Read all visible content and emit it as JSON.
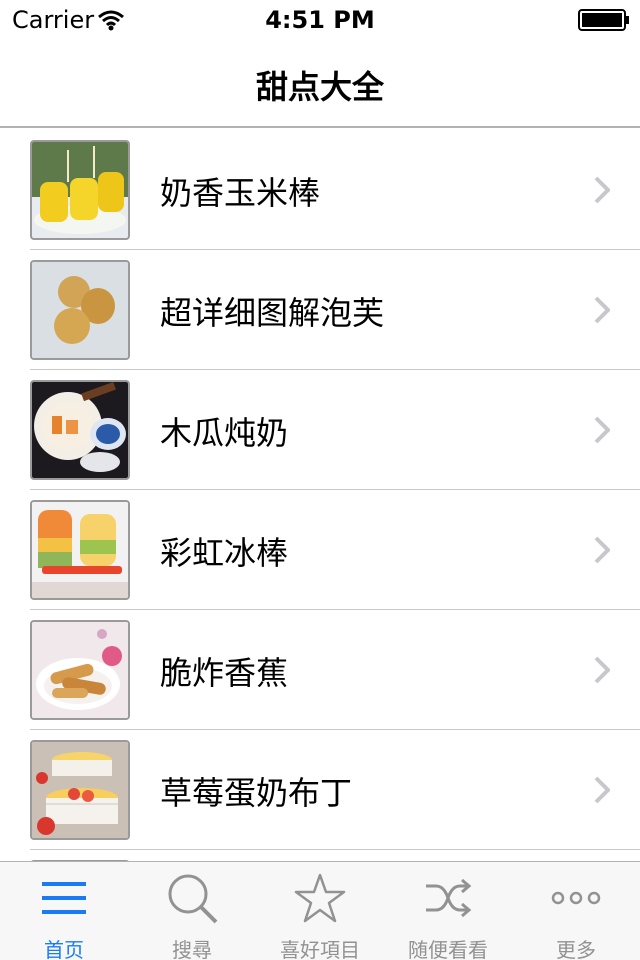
{
  "status_bar": {
    "carrier": "Carrier",
    "time": "4:51 PM"
  },
  "nav": {
    "title": "甜点大全"
  },
  "list": {
    "items": [
      {
        "label": "奶香玉米棒",
        "thumb": "corn-cob-image"
      },
      {
        "label": "超详细图解泡芙",
        "thumb": "cream-puff-image"
      },
      {
        "label": "木瓜炖奶",
        "thumb": "papaya-milk-image"
      },
      {
        "label": "彩虹冰棒",
        "thumb": "rainbow-popsicle-image"
      },
      {
        "label": "脆炸香蕉",
        "thumb": "fried-banana-image"
      },
      {
        "label": "草莓蛋奶布丁",
        "thumb": "strawberry-pudding-image"
      }
    ]
  },
  "tab_bar": {
    "tabs": [
      {
        "label": "首页",
        "icon": "menu-icon",
        "active": true
      },
      {
        "label": "搜尋",
        "icon": "search-icon",
        "active": false
      },
      {
        "label": "喜好項目",
        "icon": "star-icon",
        "active": false
      },
      {
        "label": "随便看看",
        "icon": "shuffle-icon",
        "active": false
      },
      {
        "label": "更多",
        "icon": "more-icon",
        "active": false
      }
    ]
  },
  "colors": {
    "accent": "#1a7cf5",
    "inactive": "#929292",
    "separator": "#c8c7cc"
  }
}
